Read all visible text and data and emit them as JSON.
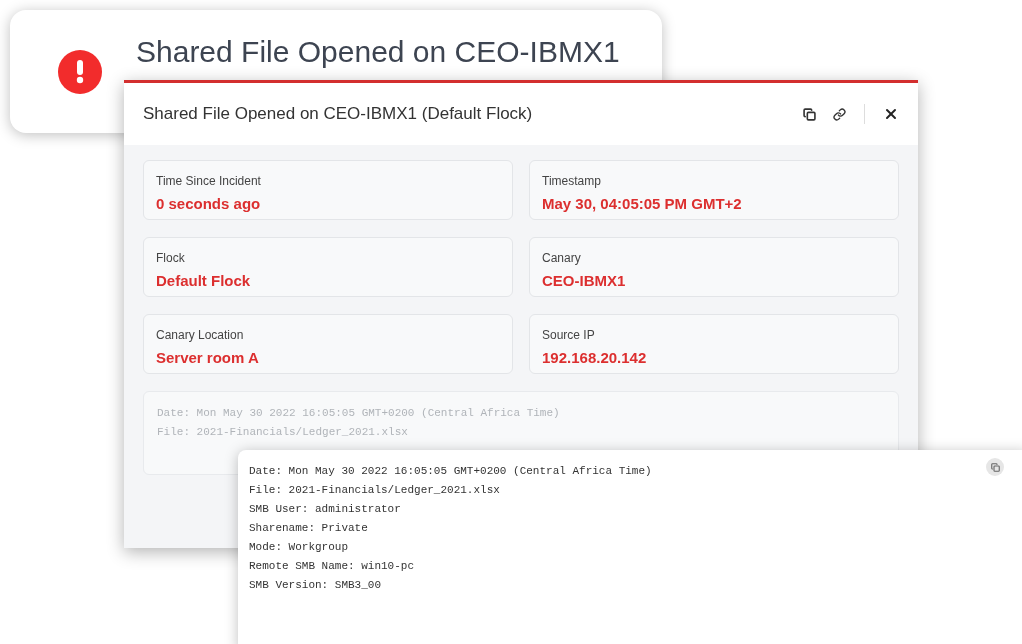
{
  "notification": {
    "title": "Shared File Opened on CEO-IBMX1"
  },
  "modal": {
    "title": "Shared File Opened on CEO-IBMX1 (Default Flock)",
    "fields": [
      {
        "label": "Time Since Incident",
        "value": "0 seconds ago"
      },
      {
        "label": "Timestamp",
        "value": "May 30, 04:05:05 PM GMT+2"
      },
      {
        "label": "Flock",
        "value": "Default Flock"
      },
      {
        "label": "Canary",
        "value": "CEO-IBMX1"
      },
      {
        "label": "Canary Location",
        "value": "Server room A"
      },
      {
        "label": "Source IP",
        "value": "192.168.20.142"
      }
    ],
    "log_preview": [
      "Date: Mon May 30 2022 16:05:05 GMT+0200 (Central Africa Time)",
      "File: 2021-Financials/Ledger_2021.xlsx"
    ]
  },
  "log_popup": {
    "lines": [
      "Date: Mon May 30 2022 16:05:05 GMT+0200 (Central Africa Time)",
      "File: 2021-Financials/Ledger_2021.xlsx",
      "SMB User: administrator",
      "Sharename: Private",
      "Mode: Workgroup",
      "Remote SMB Name: win10-pc",
      "SMB Version: SMB3_00"
    ]
  }
}
